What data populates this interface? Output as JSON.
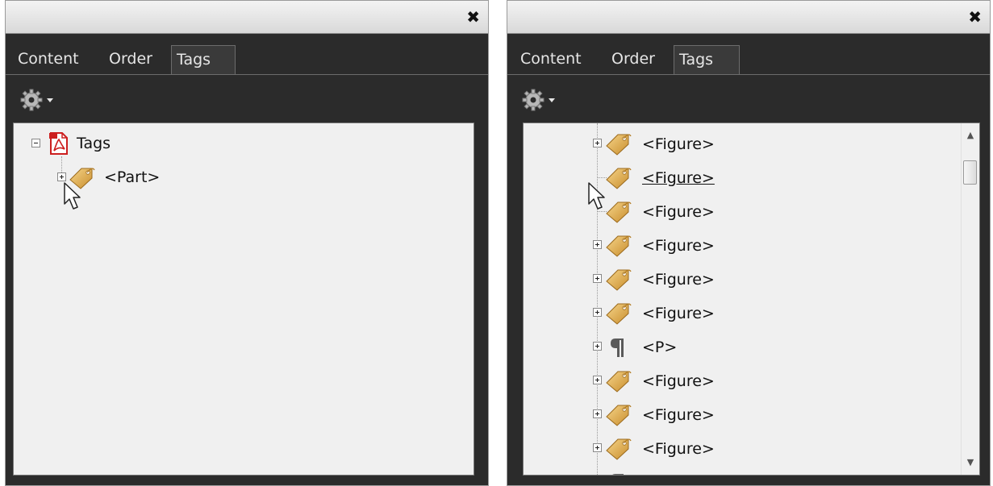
{
  "left_panel": {
    "close_glyph": "✖",
    "tabs": [
      {
        "label": "Content",
        "active": false
      },
      {
        "label": "Order",
        "active": false
      },
      {
        "label": "Tags",
        "active": true
      }
    ],
    "options_icon": "gear-icon",
    "tree": {
      "root": {
        "label": "Tags",
        "icon": "pdf-document-icon",
        "expanded": true
      },
      "children": [
        {
          "label": "<Part>",
          "icon": "tag-icon",
          "expanded": false
        }
      ]
    }
  },
  "right_panel": {
    "close_glyph": "✖",
    "tabs": [
      {
        "label": "Content",
        "active": false
      },
      {
        "label": "Order",
        "active": false
      },
      {
        "label": "Tags",
        "active": true
      }
    ],
    "options_icon": "gear-icon",
    "tree": {
      "items": [
        {
          "label": "<Figure>",
          "icon": "tag-icon",
          "expander": true
        },
        {
          "label": "<Figure>",
          "icon": "tag-icon",
          "expander": false,
          "hovered": true
        },
        {
          "label": "<Figure>",
          "icon": "tag-icon",
          "expander": false
        },
        {
          "label": "<Figure>",
          "icon": "tag-icon",
          "expander": true
        },
        {
          "label": "<Figure>",
          "icon": "tag-icon",
          "expander": true
        },
        {
          "label": "<Figure>",
          "icon": "tag-icon",
          "expander": true
        },
        {
          "label": "<P>",
          "icon": "paragraph-icon",
          "expander": true
        },
        {
          "label": "<Figure>",
          "icon": "tag-icon",
          "expander": true
        },
        {
          "label": "<Figure>",
          "icon": "tag-icon",
          "expander": true
        },
        {
          "label": "<Figure>",
          "icon": "tag-icon",
          "expander": true
        }
      ]
    }
  },
  "colors": {
    "panel_bg": "#2b2b2b",
    "tree_bg": "#f0f0f0",
    "tag_gold": "#d9a548",
    "pdf_red": "#cc1f1f"
  }
}
